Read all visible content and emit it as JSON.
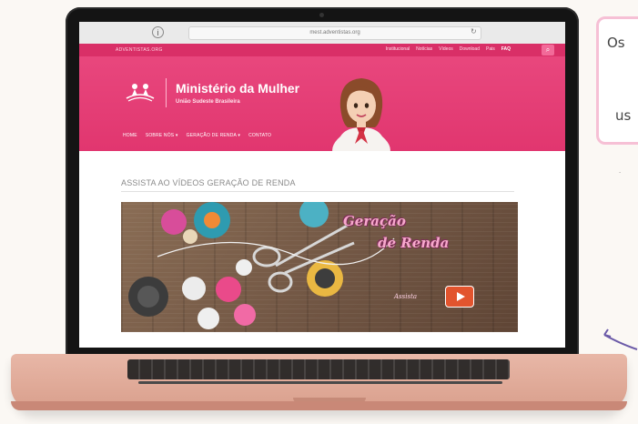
{
  "browser": {
    "url": "mest.adventistas.org",
    "info_icon": "info-icon"
  },
  "site": {
    "topbar_left": "ADVENTISTAS.ORG",
    "topnav": [
      "Institucional",
      "Notícias",
      "Vídeos",
      "Download",
      "Pais",
      "FAQ"
    ],
    "topnav_active": "FAQ",
    "title": "Ministério da Mulher",
    "subtitle": "União Sudeste Brasileira",
    "mainnav": [
      "HOME",
      "SOBRE NÓS ▾",
      "GERAÇÃO DE RENDA ▾",
      "CONTATO"
    ]
  },
  "content": {
    "section_title": "ASSISTA AO VÍDEOS GERAÇÃO DE RENDA",
    "video": {
      "title_line1": "Geração",
      "title_line2": "de Renda",
      "sub": "Assista"
    }
  },
  "overlay": {
    "line1": "Os",
    "line2": "us"
  },
  "colors": {
    "header_pink": "#e1366f",
    "laptop_rose": "#d99f8c",
    "youtube_red": "#e2542e"
  }
}
